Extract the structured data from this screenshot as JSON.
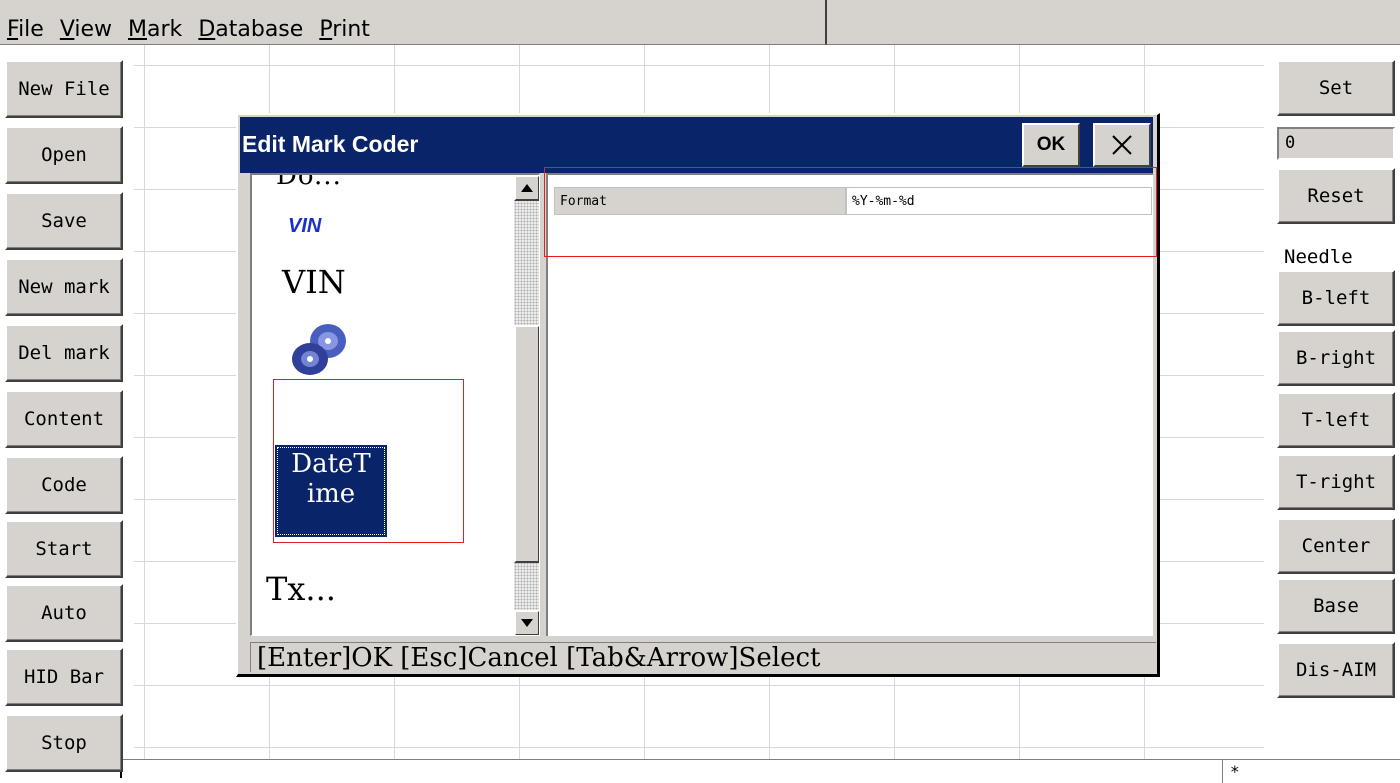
{
  "menu": [
    "File",
    "View",
    "Mark",
    "Database",
    "Print"
  ],
  "left_buttons": [
    "New File",
    "Open",
    "Save",
    "New mark",
    "Del mark",
    "Content",
    "Code",
    "Start",
    "Auto",
    "HID Bar",
    "Stop"
  ],
  "right_panel": {
    "set_label": "Set",
    "value": "0",
    "reset_label": "Reset",
    "needle_label": "Needle",
    "buttons": [
      "B-left",
      "B-right",
      "T-left",
      "T-right",
      "Center",
      "Base",
      "Dis-AIM"
    ]
  },
  "dialog": {
    "title": "Edit Mark Coder",
    "ok_label": "OK",
    "close_icon": "close-icon",
    "list": {
      "cut_top_label": "Do...",
      "vin_icon_label": "VIN",
      "vin_label": "VIN",
      "datetime_icon": "cd-disc-icon",
      "datetime_label_1": "DateT",
      "datetime_label_2": "ime",
      "txt_label": "Tx..."
    },
    "properties": [
      {
        "key": "Format",
        "value": "%Y-%m-%d"
      }
    ],
    "status": "[Enter]OK [Esc]Cancel [Tab&Arrow]Select"
  },
  "bottom_bar": {
    "marker": "*"
  },
  "colors": {
    "titlebar": "#0a246a",
    "face": "#d6d3ce",
    "highlight_box": "#e02020"
  }
}
